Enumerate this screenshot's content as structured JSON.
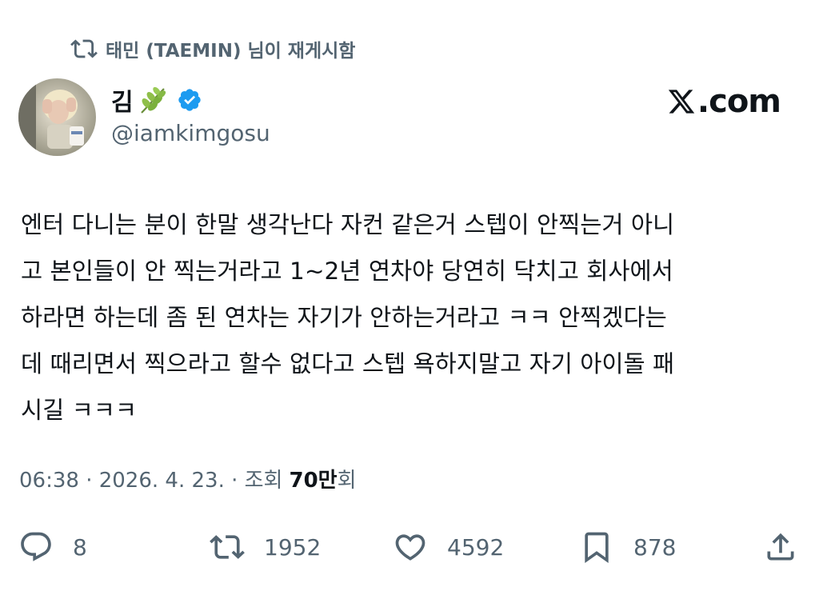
{
  "repost": {
    "label": "태민 (TAEMIN) 님이 재게시함",
    "icon": "repost-icon"
  },
  "author": {
    "display_name": "김",
    "name_emoji": "leaf-emoji",
    "verified": true,
    "handle": "@iamkimgosu"
  },
  "brand": {
    "label": ".com",
    "icon": "x-logo-icon"
  },
  "tweet": {
    "text": "엔터 다니는 분이 한말 생각난다 자컨 같은거 스텝이 안찍는거 아니\n고 본인들이 안 찍는거라고 1~2년 연차야 당연히 닥치고 회사에서\n하라면 하는데 좀 된 연차는 자기가 안하는거라고 ㅋㅋ 안찍겠다는\n데 때리면서 찍으라고 할수 없다고 스텝 욕하지말고 자기 아이돌 패\n시길 ㅋㅋㅋ"
  },
  "meta": {
    "time_date": "06:38 · 2026. 4. 23. · 조회",
    "views": "70만",
    "views_suffix": "회"
  },
  "actions": {
    "replies": "8",
    "reposts": "1952",
    "likes": "4592",
    "bookmarks": "878"
  },
  "colors": {
    "text_primary": "#0f1419",
    "text_secondary": "#536471",
    "verified_blue": "#1d9bf0"
  }
}
